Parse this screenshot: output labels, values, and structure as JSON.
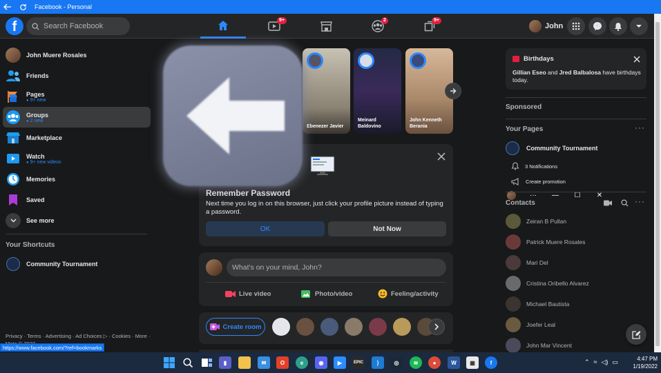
{
  "window": {
    "title": "Facebook - Personal",
    "back_icon": "back-arrow-icon",
    "refresh_icon": "refresh-icon",
    "menu_glyph": "···",
    "minimize_glyph": "—",
    "maximize_glyph": "☐",
    "close_glyph": "✕"
  },
  "header": {
    "search_placeholder": "Search Facebook",
    "user_name": "John",
    "nav_tabs": [
      {
        "name": "home",
        "active": true,
        "badge": ""
      },
      {
        "name": "watch",
        "active": false,
        "badge": "9+"
      },
      {
        "name": "marketplace",
        "active": false,
        "badge": ""
      },
      {
        "name": "groups",
        "active": false,
        "badge": "2"
      },
      {
        "name": "gaming",
        "active": false,
        "badge": "9+"
      }
    ]
  },
  "sidebar": {
    "items": [
      {
        "label": "John Muere Rosales",
        "sub": ""
      },
      {
        "label": "Friends",
        "sub": ""
      },
      {
        "label": "Pages",
        "sub": "9+ new"
      },
      {
        "label": "Groups",
        "sub": "2 new"
      },
      {
        "label": "Marketplace",
        "sub": ""
      },
      {
        "label": "Watch",
        "sub": "9+ new videos"
      },
      {
        "label": "Memories",
        "sub": ""
      },
      {
        "label": "Saved",
        "sub": ""
      },
      {
        "label": "See more",
        "sub": ""
      }
    ],
    "shortcuts_heading": "Your Shortcuts",
    "shortcuts": [
      {
        "label": "Community Tournament"
      }
    ],
    "footer": "Privacy · Terms · Advertising · Ad Choices ▷ · Cookies · More · Meta © 2022"
  },
  "status_url": "https://www.facebook.com/?ref=bookmarks",
  "stories": [
    {
      "name": "Ebenezer Javier"
    },
    {
      "name": "Meinard Baldovino"
    },
    {
      "name": "John Kenneth Berania"
    }
  ],
  "remember_password": {
    "title": "Remember Password",
    "description": "Next time you log in on this browser, just click your profile picture instead of typing a password.",
    "ok_label": "OK",
    "not_now_label": "Not Now"
  },
  "composer": {
    "placeholder": "What's on your mind, John?",
    "live_video": "Live video",
    "photo_video": "Photo/video",
    "feeling_activity": "Feeling/activity"
  },
  "rooms": {
    "create_label": "Create room"
  },
  "right": {
    "birthdays_title": "Birthdays",
    "birthday_name1": "Gillian Eseo",
    "birthday_and": " and ",
    "birthday_name2": "Jred Balbalosa",
    "birthday_rest": " have birthdays today.",
    "sponsored": "Sponsored",
    "your_pages": "Your Pages",
    "page_name": "Community Tournament",
    "notifications": "3 Notifications",
    "create_promotion": "Create promotion",
    "contacts_heading": "Contacts",
    "contacts": [
      "Zeiran B Pullan",
      "Patrick Muere Rosales",
      "Mari Del",
      "Cristina Oribello Alvarez",
      "Michael Bautista",
      "Joefer Leal",
      "John Mar Vincent"
    ]
  },
  "taskbar": {
    "time": "4:47 PM",
    "date": "1/19/2022"
  },
  "colors": {
    "accent": "#1877f2",
    "badge": "#e41e3f",
    "bg": "#18191a",
    "card": "#242526"
  }
}
